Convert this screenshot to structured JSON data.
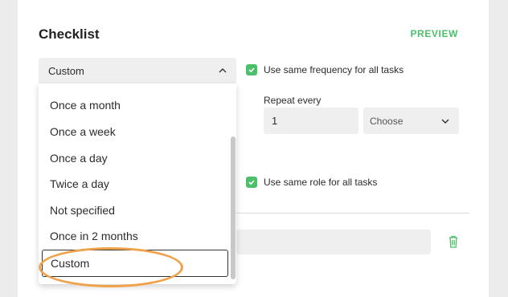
{
  "section": {
    "title": "Checklist",
    "preview_label": "PREVIEW"
  },
  "frequency_select": {
    "selected": "Custom",
    "options": [
      "Once a month",
      "Once a week",
      "Once a day",
      "Twice a day",
      "Not specified",
      "Once in 2 months",
      "Custom"
    ]
  },
  "same_frequency": {
    "label": "Use same frequency for all tasks",
    "checked": true
  },
  "repeat": {
    "label": "Repeat every",
    "value": "1",
    "unit_placeholder": "Choose"
  },
  "same_role": {
    "label": "Use same role for all tasks",
    "checked": true
  },
  "colors": {
    "accent": "#4cbf6a",
    "annotation": "#f0a24a"
  }
}
